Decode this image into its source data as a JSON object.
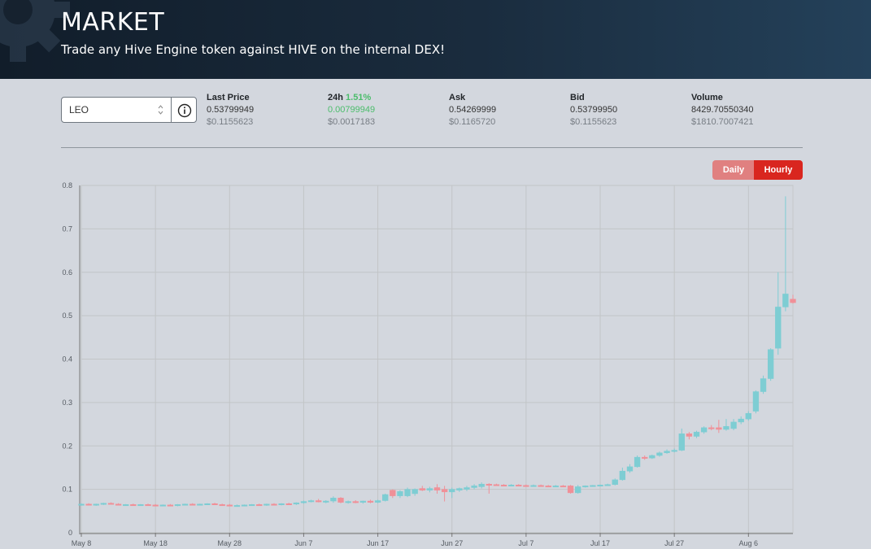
{
  "header": {
    "title": "MARKET",
    "subtitle": "Trade any Hive Engine token against HIVE on the internal DEX!"
  },
  "token_select": {
    "value": "LEO"
  },
  "stats": {
    "last_price": {
      "label": "Last Price",
      "value": "0.53799949",
      "usd": "$0.1155623"
    },
    "change_24h": {
      "label": "24h",
      "pct": "1.51%",
      "value": "0.00799949",
      "usd": "$0.0017183"
    },
    "ask": {
      "label": "Ask",
      "value": "0.54269999",
      "usd": "$0.1165720"
    },
    "bid": {
      "label": "Bid",
      "value": "0.53799950",
      "usd": "$0.1155623"
    },
    "volume": {
      "label": "Volume",
      "value": "8429.70550340",
      "usd": "$1810.7007421"
    }
  },
  "interval_toggle": {
    "daily": "Daily",
    "hourly": "Hourly",
    "active": "Hourly"
  },
  "colors": {
    "up": "#7ecdd3",
    "down": "#f09098",
    "active": "#d9261f",
    "accent_green": "#4bbd6b"
  },
  "chart_data": {
    "type": "candlestick",
    "x_tick_labels": [
      "May 8",
      "May 18",
      "May 28",
      "Jun 7",
      "Jun 17",
      "Jun 27",
      "Jul 7",
      "Jul 17",
      "Jul 27",
      "Aug 6"
    ],
    "y_tick_labels": [
      "0",
      "0.1",
      "0.2",
      "0.3",
      "0.4",
      "0.5",
      "0.6",
      "0.7",
      "0.8"
    ],
    "ylim": [
      0,
      0.8
    ],
    "grid": true,
    "candles": [
      {
        "x": 0,
        "o": 0.065,
        "h": 0.068,
        "l": 0.062,
        "c": 0.066
      },
      {
        "x": 1,
        "o": 0.066,
        "h": 0.068,
        "l": 0.063,
        "c": 0.064
      },
      {
        "x": 2,
        "o": 0.064,
        "h": 0.067,
        "l": 0.062,
        "c": 0.066
      },
      {
        "x": 3,
        "o": 0.066,
        "h": 0.069,
        "l": 0.064,
        "c": 0.068
      },
      {
        "x": 4,
        "o": 0.068,
        "h": 0.07,
        "l": 0.065,
        "c": 0.066
      },
      {
        "x": 5,
        "o": 0.066,
        "h": 0.068,
        "l": 0.063,
        "c": 0.064
      },
      {
        "x": 6,
        "o": 0.064,
        "h": 0.066,
        "l": 0.062,
        "c": 0.065
      },
      {
        "x": 7,
        "o": 0.065,
        "h": 0.067,
        "l": 0.063,
        "c": 0.064
      },
      {
        "x": 8,
        "o": 0.064,
        "h": 0.066,
        "l": 0.062,
        "c": 0.065
      },
      {
        "x": 9,
        "o": 0.065,
        "h": 0.067,
        "l": 0.063,
        "c": 0.064
      },
      {
        "x": 10,
        "o": 0.064,
        "h": 0.066,
        "l": 0.062,
        "c": 0.063
      },
      {
        "x": 11,
        "o": 0.063,
        "h": 0.065,
        "l": 0.061,
        "c": 0.064
      },
      {
        "x": 12,
        "o": 0.064,
        "h": 0.066,
        "l": 0.062,
        "c": 0.063
      },
      {
        "x": 13,
        "o": 0.063,
        "h": 0.066,
        "l": 0.061,
        "c": 0.065
      },
      {
        "x": 14,
        "o": 0.065,
        "h": 0.067,
        "l": 0.063,
        "c": 0.066
      },
      {
        "x": 15,
        "o": 0.066,
        "h": 0.068,
        "l": 0.064,
        "c": 0.065
      },
      {
        "x": 16,
        "o": 0.065,
        "h": 0.067,
        "l": 0.063,
        "c": 0.066
      },
      {
        "x": 17,
        "o": 0.066,
        "h": 0.068,
        "l": 0.064,
        "c": 0.067
      },
      {
        "x": 18,
        "o": 0.067,
        "h": 0.069,
        "l": 0.064,
        "c": 0.065
      },
      {
        "x": 19,
        "o": 0.065,
        "h": 0.067,
        "l": 0.062,
        "c": 0.064
      },
      {
        "x": 20,
        "o": 0.064,
        "h": 0.066,
        "l": 0.061,
        "c": 0.062
      },
      {
        "x": 21,
        "o": 0.062,
        "h": 0.065,
        "l": 0.06,
        "c": 0.063
      },
      {
        "x": 22,
        "o": 0.063,
        "h": 0.065,
        "l": 0.061,
        "c": 0.064
      },
      {
        "x": 23,
        "o": 0.064,
        "h": 0.066,
        "l": 0.062,
        "c": 0.065
      },
      {
        "x": 24,
        "o": 0.065,
        "h": 0.067,
        "l": 0.063,
        "c": 0.064
      },
      {
        "x": 25,
        "o": 0.064,
        "h": 0.067,
        "l": 0.062,
        "c": 0.066
      },
      {
        "x": 26,
        "o": 0.066,
        "h": 0.068,
        "l": 0.064,
        "c": 0.065
      },
      {
        "x": 27,
        "o": 0.065,
        "h": 0.068,
        "l": 0.063,
        "c": 0.067
      },
      {
        "x": 28,
        "o": 0.067,
        "h": 0.069,
        "l": 0.065,
        "c": 0.066
      },
      {
        "x": 29,
        "o": 0.066,
        "h": 0.07,
        "l": 0.064,
        "c": 0.069
      },
      {
        "x": 30,
        "o": 0.069,
        "h": 0.074,
        "l": 0.067,
        "c": 0.072
      },
      {
        "x": 31,
        "o": 0.072,
        "h": 0.076,
        "l": 0.07,
        "c": 0.074
      },
      {
        "x": 32,
        "o": 0.074,
        "h": 0.078,
        "l": 0.07,
        "c": 0.071
      },
      {
        "x": 33,
        "o": 0.071,
        "h": 0.075,
        "l": 0.068,
        "c": 0.073
      },
      {
        "x": 34,
        "o": 0.073,
        "h": 0.084,
        "l": 0.069,
        "c": 0.08
      },
      {
        "x": 35,
        "o": 0.08,
        "h": 0.082,
        "l": 0.068,
        "c": 0.07
      },
      {
        "x": 36,
        "o": 0.07,
        "h": 0.074,
        "l": 0.067,
        "c": 0.072
      },
      {
        "x": 37,
        "o": 0.072,
        "h": 0.075,
        "l": 0.068,
        "c": 0.07
      },
      {
        "x": 38,
        "o": 0.07,
        "h": 0.074,
        "l": 0.067,
        "c": 0.073
      },
      {
        "x": 39,
        "o": 0.073,
        "h": 0.076,
        "l": 0.068,
        "c": 0.07
      },
      {
        "x": 40,
        "o": 0.07,
        "h": 0.076,
        "l": 0.068,
        "c": 0.074
      },
      {
        "x": 41,
        "o": 0.074,
        "h": 0.09,
        "l": 0.072,
        "c": 0.088
      },
      {
        "x": 42,
        "o": 0.098,
        "h": 0.1,
        "l": 0.08,
        "c": 0.085
      },
      {
        "x": 43,
        "o": 0.085,
        "h": 0.098,
        "l": 0.08,
        "c": 0.095
      },
      {
        "x": 44,
        "o": 0.085,
        "h": 0.104,
        "l": 0.082,
        "c": 0.1
      },
      {
        "x": 45,
        "o": 0.09,
        "h": 0.102,
        "l": 0.085,
        "c": 0.1
      },
      {
        "x": 46,
        "o": 0.102,
        "h": 0.108,
        "l": 0.096,
        "c": 0.098
      },
      {
        "x": 47,
        "o": 0.098,
        "h": 0.106,
        "l": 0.093,
        "c": 0.102
      },
      {
        "x": 48,
        "o": 0.104,
        "h": 0.112,
        "l": 0.09,
        "c": 0.098
      },
      {
        "x": 49,
        "o": 0.1,
        "h": 0.108,
        "l": 0.072,
        "c": 0.094
      },
      {
        "x": 50,
        "o": 0.094,
        "h": 0.104,
        "l": 0.08,
        "c": 0.1
      },
      {
        "x": 51,
        "o": 0.098,
        "h": 0.104,
        "l": 0.094,
        "c": 0.102
      },
      {
        "x": 52,
        "o": 0.1,
        "h": 0.108,
        "l": 0.096,
        "c": 0.104
      },
      {
        "x": 53,
        "o": 0.104,
        "h": 0.112,
        "l": 0.1,
        "c": 0.108
      },
      {
        "x": 54,
        "o": 0.106,
        "h": 0.116,
        "l": 0.102,
        "c": 0.112
      },
      {
        "x": 55,
        "o": 0.112,
        "h": 0.114,
        "l": 0.09,
        "c": 0.11
      },
      {
        "x": 56,
        "o": 0.111,
        "h": 0.113,
        "l": 0.108,
        "c": 0.11
      },
      {
        "x": 57,
        "o": 0.11,
        "h": 0.112,
        "l": 0.107,
        "c": 0.109
      },
      {
        "x": 58,
        "o": 0.109,
        "h": 0.112,
        "l": 0.107,
        "c": 0.11
      },
      {
        "x": 59,
        "o": 0.11,
        "h": 0.112,
        "l": 0.107,
        "c": 0.109
      },
      {
        "x": 60,
        "o": 0.109,
        "h": 0.111,
        "l": 0.106,
        "c": 0.108
      },
      {
        "x": 61,
        "o": 0.108,
        "h": 0.111,
        "l": 0.106,
        "c": 0.109
      },
      {
        "x": 62,
        "o": 0.109,
        "h": 0.111,
        "l": 0.106,
        "c": 0.108
      },
      {
        "x": 63,
        "o": 0.108,
        "h": 0.11,
        "l": 0.105,
        "c": 0.107
      },
      {
        "x": 64,
        "o": 0.107,
        "h": 0.11,
        "l": 0.105,
        "c": 0.108
      },
      {
        "x": 65,
        "o": 0.108,
        "h": 0.11,
        "l": 0.105,
        "c": 0.107
      },
      {
        "x": 66,
        "o": 0.108,
        "h": 0.11,
        "l": 0.09,
        "c": 0.092
      },
      {
        "x": 67,
        "o": 0.092,
        "h": 0.11,
        "l": 0.09,
        "c": 0.106
      },
      {
        "x": 68,
        "o": 0.106,
        "h": 0.109,
        "l": 0.104,
        "c": 0.108
      },
      {
        "x": 69,
        "o": 0.108,
        "h": 0.11,
        "l": 0.106,
        "c": 0.109
      },
      {
        "x": 70,
        "o": 0.109,
        "h": 0.111,
        "l": 0.107,
        "c": 0.11
      },
      {
        "x": 71,
        "o": 0.11,
        "h": 0.113,
        "l": 0.108,
        "c": 0.111
      },
      {
        "x": 72,
        "o": 0.111,
        "h": 0.125,
        "l": 0.109,
        "c": 0.122
      },
      {
        "x": 73,
        "o": 0.122,
        "h": 0.15,
        "l": 0.12,
        "c": 0.142
      },
      {
        "x": 74,
        "o": 0.142,
        "h": 0.158,
        "l": 0.138,
        "c": 0.152
      },
      {
        "x": 75,
        "o": 0.152,
        "h": 0.178,
        "l": 0.15,
        "c": 0.174
      },
      {
        "x": 76,
        "o": 0.174,
        "h": 0.178,
        "l": 0.168,
        "c": 0.172
      },
      {
        "x": 77,
        "o": 0.172,
        "h": 0.18,
        "l": 0.17,
        "c": 0.178
      },
      {
        "x": 78,
        "o": 0.178,
        "h": 0.187,
        "l": 0.175,
        "c": 0.184
      },
      {
        "x": 79,
        "o": 0.184,
        "h": 0.192,
        "l": 0.182,
        "c": 0.188
      },
      {
        "x": 80,
        "o": 0.188,
        "h": 0.194,
        "l": 0.185,
        "c": 0.19
      },
      {
        "x": 81,
        "o": 0.19,
        "h": 0.24,
        "l": 0.188,
        "c": 0.228
      },
      {
        "x": 82,
        "o": 0.228,
        "h": 0.232,
        "l": 0.215,
        "c": 0.222
      },
      {
        "x": 83,
        "o": 0.222,
        "h": 0.235,
        "l": 0.218,
        "c": 0.232
      },
      {
        "x": 84,
        "o": 0.232,
        "h": 0.245,
        "l": 0.228,
        "c": 0.242
      },
      {
        "x": 85,
        "o": 0.242,
        "h": 0.248,
        "l": 0.236,
        "c": 0.24
      },
      {
        "x": 86,
        "o": 0.242,
        "h": 0.26,
        "l": 0.23,
        "c": 0.238
      },
      {
        "x": 87,
        "o": 0.238,
        "h": 0.262,
        "l": 0.235,
        "c": 0.245
      },
      {
        "x": 88,
        "o": 0.24,
        "h": 0.262,
        "l": 0.236,
        "c": 0.255
      },
      {
        "x": 89,
        "o": 0.255,
        "h": 0.268,
        "l": 0.25,
        "c": 0.262
      },
      {
        "x": 90,
        "o": 0.262,
        "h": 0.28,
        "l": 0.258,
        "c": 0.275
      },
      {
        "x": 91,
        "o": 0.28,
        "h": 0.328,
        "l": 0.275,
        "c": 0.325
      },
      {
        "x": 92,
        "o": 0.325,
        "h": 0.362,
        "l": 0.32,
        "c": 0.355
      },
      {
        "x": 93,
        "o": 0.355,
        "h": 0.425,
        "l": 0.35,
        "c": 0.422
      },
      {
        "x": 94,
        "o": 0.425,
        "h": 0.6,
        "l": 0.41,
        "c": 0.52
      },
      {
        "x": 95,
        "o": 0.52,
        "h": 0.775,
        "l": 0.51,
        "c": 0.55
      },
      {
        "x": 96,
        "o": 0.538,
        "h": 0.548,
        "l": 0.528,
        "c": 0.53
      }
    ],
    "x_count": 97
  }
}
